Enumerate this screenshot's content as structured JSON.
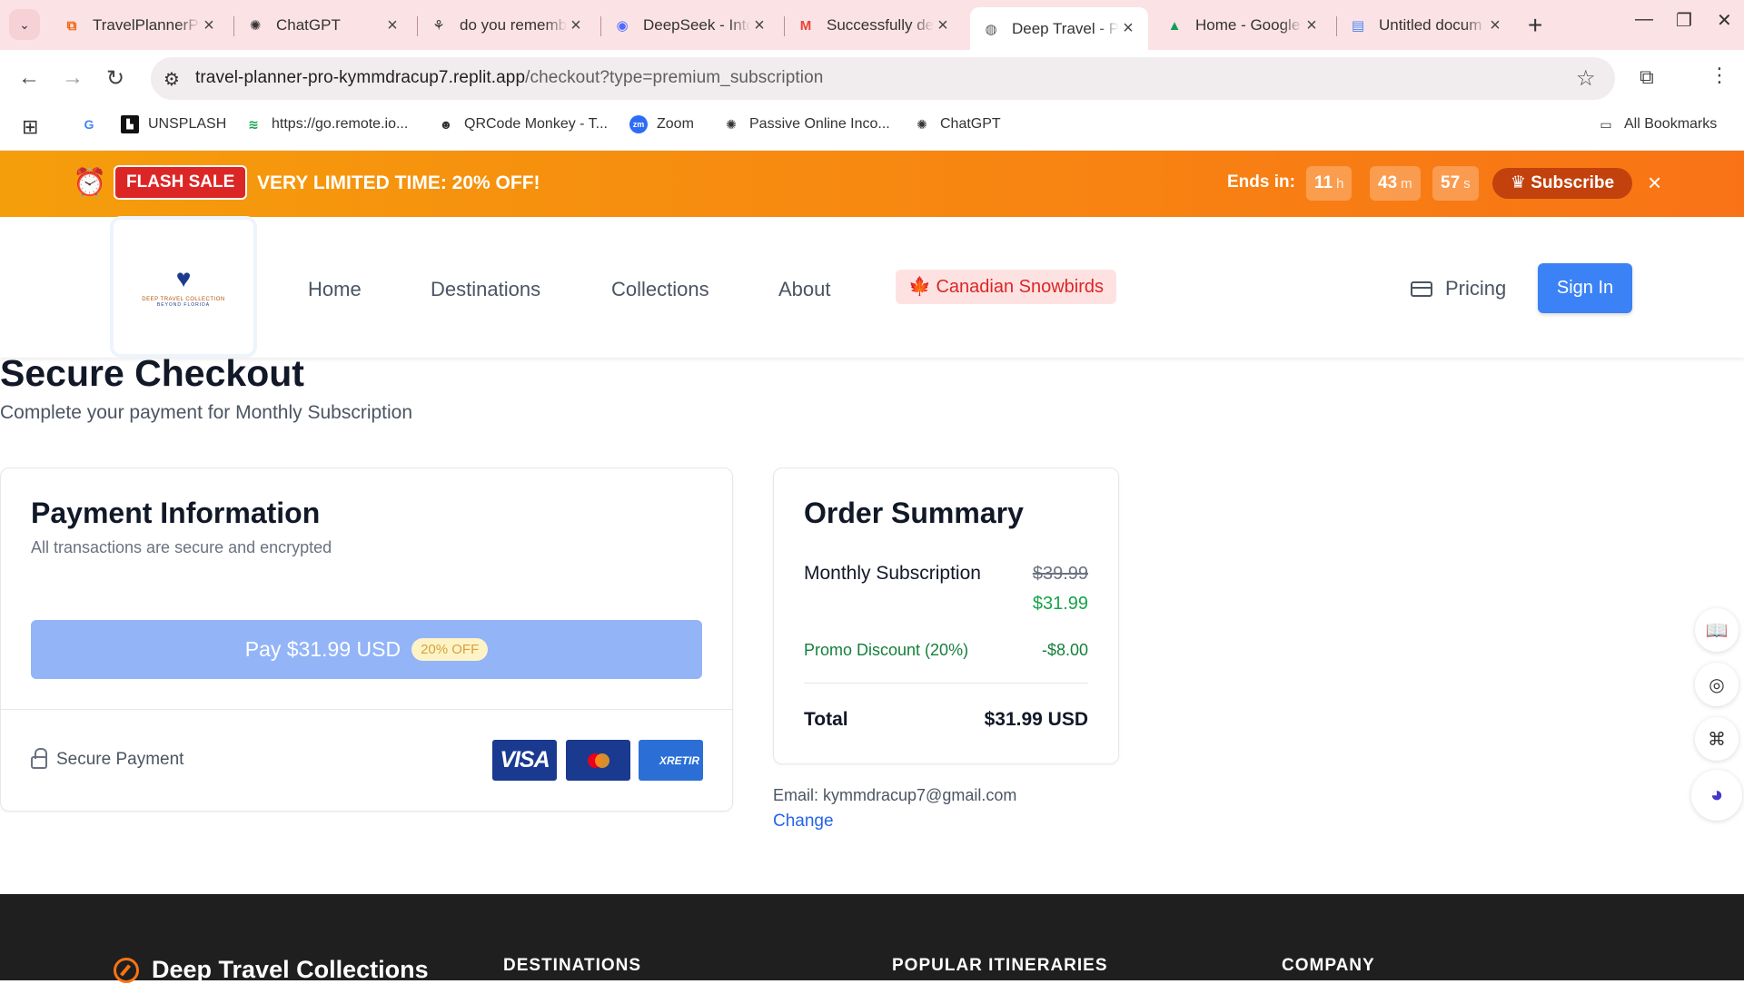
{
  "browser": {
    "tabs": [
      {
        "title": "TravelPlannerPro",
        "icon": "replit-icon",
        "active": false
      },
      {
        "title": "ChatGPT",
        "icon": "chatgpt-icon",
        "active": false
      },
      {
        "title": "do you remember",
        "icon": "app-icon",
        "active": false
      },
      {
        "title": "DeepSeek - Into",
        "icon": "deepseek-icon",
        "active": false
      },
      {
        "title": "Successfully de",
        "icon": "gmail-icon",
        "active": false
      },
      {
        "title": "Deep Travel - Pr",
        "icon": "globe-icon",
        "active": true
      },
      {
        "title": "Home - Google",
        "icon": "google-drive-icon",
        "active": false
      },
      {
        "title": "Untitled docum",
        "icon": "google-docs-icon",
        "active": false
      }
    ],
    "url_host": "travel-planner-pro-kymmdracup7.replit.app",
    "url_path": "/checkout?type=premium_subscription",
    "bookmarks": [
      {
        "label": "",
        "icon": "google-icon"
      },
      {
        "label": "UNSPLASH",
        "icon": "unsplash-icon"
      },
      {
        "label": "https://go.remote.io...",
        "icon": "remote-icon"
      },
      {
        "label": "QRCode Monkey - T...",
        "icon": "qrcode-monkey-icon"
      },
      {
        "label": "Zoom",
        "icon": "zoom-icon"
      },
      {
        "label": "Passive Online Inco...",
        "icon": "chatgpt-icon"
      },
      {
        "label": "ChatGPT",
        "icon": "chatgpt-icon"
      }
    ],
    "all_bookmarks": "All Bookmarks"
  },
  "flash": {
    "badge": "FLASH SALE",
    "text": "VERY LIMITED TIME:  20% OFF!",
    "ends_label": "Ends in:",
    "hours": "11",
    "hours_unit": "h",
    "minutes": "43",
    "minutes_unit": "m",
    "seconds": "57",
    "seconds_unit": "s",
    "subscribe": "Subscribe"
  },
  "nav": {
    "home": "Home",
    "destinations": "Destinations",
    "collections": "Collections",
    "about": "About",
    "snowbirds": "Canadian Snowbirds",
    "pricing": "Pricing",
    "signin": "Sign In"
  },
  "logo": {
    "line1": "DEEP TRAVEL COLLECTION",
    "line2": "BEYOND FLORIDA"
  },
  "checkout": {
    "title": "Secure Checkout",
    "subtitle": "Complete your payment for Monthly Subscription",
    "payment": {
      "title": "Payment Information",
      "subtitle": "All transactions are secure and encrypted",
      "button": "Pay $31.99 USD",
      "button_badge": "20% OFF",
      "secure": "Secure Payment",
      "cards": [
        "VISA",
        "mastercard",
        "XRETIR"
      ]
    },
    "order": {
      "title": "Order Summary",
      "item": "Monthly Subscription",
      "old_price": "$39.99",
      "new_price": "$31.99",
      "promo_label": "Promo Discount (20%)",
      "promo_value": "-$8.00",
      "total_label": "Total",
      "total_value": "$31.99 USD"
    },
    "email": "Email: kymmdracup7@gmail.com",
    "change": "Change"
  },
  "footer": {
    "brand": "Deep Travel Collections",
    "col1": "DESTINATIONS",
    "col2": "POPULAR ITINERARIES",
    "col3": "COMPANY"
  },
  "colors": {
    "accent": "#3b82f6",
    "flash_start": "#f59e0b",
    "flash_end": "#f97316",
    "promo_green": "#15803d"
  }
}
